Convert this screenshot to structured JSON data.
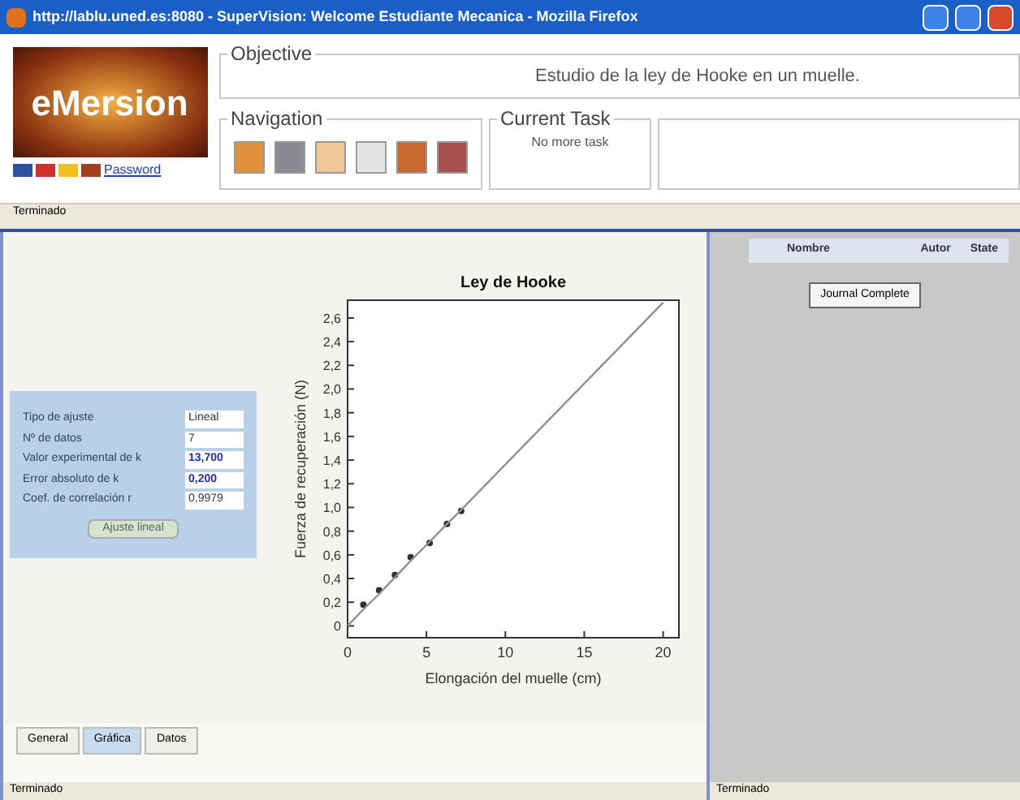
{
  "window": {
    "title": "http://lablu.uned.es:8080 - SuperVision: Welcome Estudiante Mecanica - Mozilla Firefox"
  },
  "logo": {
    "text": "eMersion",
    "link": "Password"
  },
  "objective": {
    "label": "Objective",
    "text": "Estudio de la ley de Hooke en un muelle."
  },
  "navigation": {
    "label": "Navigation",
    "buttons": [
      {
        "color": "#e0903a"
      },
      {
        "color": "#8a8a94"
      },
      {
        "color": "#f0c898"
      },
      {
        "color": "#e4e4e4"
      },
      {
        "color": "#c86a30"
      },
      {
        "color": "#a85050"
      }
    ]
  },
  "current_task": {
    "label": "Current Task",
    "text": "No more task"
  },
  "top_status": "Terminado",
  "fit_panel": {
    "fields": [
      {
        "label": "Tipo de ajuste",
        "value": "Lineal",
        "emphasis": false
      },
      {
        "label": "Nº de datos",
        "value": "7",
        "emphasis": false
      },
      {
        "label": "Valor experimental de k",
        "value": "13,700",
        "emphasis": true
      },
      {
        "label": "Error absoluto de k",
        "value": "0,200",
        "emphasis": true
      },
      {
        "label": "Coef. de correlación r",
        "value": "0,9979",
        "emphasis": false
      }
    ],
    "button": "Ajuste lineal"
  },
  "chart": {
    "chart_data": {
      "type": "scatter",
      "title": "Ley de Hooke",
      "xlabel": "Elongación del muelle (cm)",
      "ylabel": "Fuerza de recuperación (N)",
      "x": [
        0,
        1,
        2,
        3,
        4,
        5.2,
        6.3,
        7.2,
        20
      ],
      "series": [
        {
          "type": "scatter",
          "color": "#303030",
          "values": [
            null,
            0.18,
            0.3,
            0.43,
            0.58,
            0.7,
            0.86,
            0.97,
            null
          ]
        },
        {
          "type": "line",
          "color": "#909090",
          "values": [
            0,
            0.14,
            0.27,
            0.41,
            0.55,
            0.71,
            0.86,
            0.98,
            2.73
          ]
        }
      ],
      "xlim": [
        0,
        21
      ],
      "ylim": [
        -0.1,
        2.75
      ],
      "xticks": [
        0,
        5,
        10,
        15,
        20
      ],
      "yticks": [
        {
          "value": 0,
          "label": "0"
        },
        {
          "value": 0.2,
          "label": "0,2"
        },
        {
          "value": 0.4,
          "label": "0,4"
        },
        {
          "value": 0.6,
          "label": "0,6"
        },
        {
          "value": 0.8,
          "label": "0,8"
        },
        {
          "value": 1.0,
          "label": "1,0"
        },
        {
          "value": 1.2,
          "label": "1,2"
        },
        {
          "value": 1.4,
          "label": "1,4"
        },
        {
          "value": 1.6,
          "label": "1,6"
        },
        {
          "value": 1.8,
          "label": "1,8"
        },
        {
          "value": 2.0,
          "label": "2,0"
        },
        {
          "value": 2.2,
          "label": "2,2"
        },
        {
          "value": 2.4,
          "label": "2,4"
        },
        {
          "value": 2.6,
          "label": "2,6"
        }
      ]
    }
  },
  "tabs": [
    {
      "label": "General",
      "selected": false
    },
    {
      "label": "Gráfica",
      "selected": true
    },
    {
      "label": "Datos",
      "selected": false
    }
  ],
  "journal": {
    "columns": [
      "Nombre",
      "Autor",
      "State"
    ],
    "button": "Journal Complete"
  },
  "status_bars": [
    "Terminado",
    "Terminado"
  ]
}
